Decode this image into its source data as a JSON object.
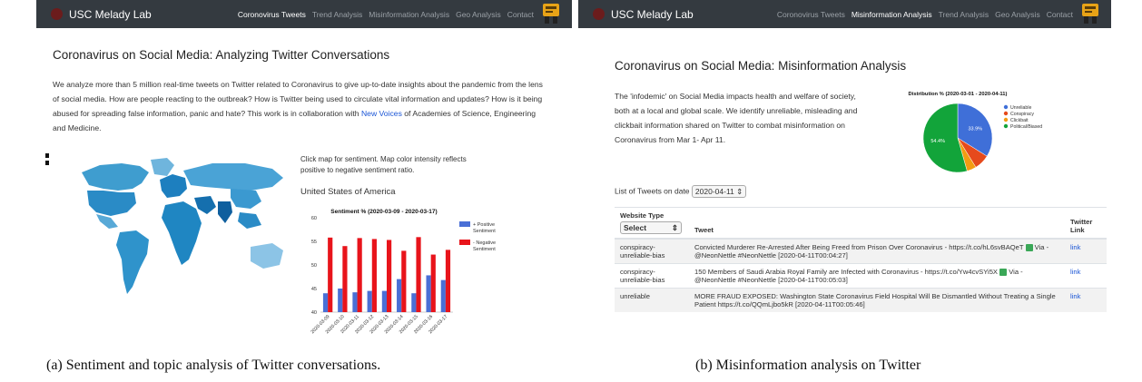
{
  "panel_a": {
    "brand": "USC Melady Lab",
    "nav": [
      "Coronovirus Tweets",
      "Trend Analysis",
      "Misinformation Analysis",
      "Geo Analysis",
      "Contact"
    ],
    "active_nav": "Coronovirus Tweets",
    "title": "Coronavirus on Social Media: Analyzing Twitter Conversations",
    "intro": {
      "text": "We analyze more than 5 million real-time tweets on Twitter related to Coronavirus to give up-to-date insights about the pandemic from the lens of social media. How are people reacting to the outbreak? How is Twitter being used to circulate vital information and updates? How is it being abused for spreading false information, panic and hate? This work is in collaboration with ",
      "link_text": "New Voices",
      "text_after": " of Academies of Science, Engineering and Medicine."
    },
    "map_hint": "Click map for sentiment. Map color intensity reflects positive to negative sentiment ratio.",
    "selected_country": "United States of America",
    "caption": "(a) Sentiment and topic analysis of Twitter conversations."
  },
  "panel_b": {
    "brand": "USC Melady Lab",
    "nav": [
      "Coronovirus Tweets",
      "Misinformation Analysis",
      "Trend Analysis",
      "Geo Analysis",
      "Contact"
    ],
    "active_nav": "Misinformation Analysis",
    "title": "Coronavirus on Social Media: Misinformation Analysis",
    "intro": "The 'infodemic' on Social Media impacts health and welfare of society, both at a local and global scale. We identify unreliable, misleading and clickbait information shared on Twitter to combat misinformation on Coronavirus from Mar 1- Apr 11.",
    "date_label": "List of Tweets on date",
    "date_value": "2020-04-11",
    "table": {
      "headers": [
        "Website Type",
        "Tweet",
        "Twitter Link"
      ],
      "filter_value": "Select",
      "rows": [
        {
          "type": "conspiracy-unreliable-bias",
          "tweet": "Convicted Murderer Re-Arrested After Being Freed from Prison Over Coronavirus - https://t.co/hL6svBAQeT",
          "tweet_after": " Via - @NeonNettle #NeonNettle [2020-04-11T00:04:27]",
          "link": "link"
        },
        {
          "type": "conspiracy-unreliable-bias",
          "tweet": "150 Members of Saudi Arabia Royal Family are Infected with Coronavirus - https://t.co/Yw4cvSYi5X",
          "tweet_after": " Via - @NeonNettle #NeonNettle [2020-04-11T00:05:03]",
          "link": "link"
        },
        {
          "type": "unreliable",
          "tweet": "MORE FRAUD EXPOSED: Washington State Coronavirus Field Hospital Will Be Dismantled Without Treating a Single Patient https://t.co/QQmLjbo5kR [2020-04-11T00:05:46]",
          "tweet_after": "",
          "link": "link"
        }
      ]
    },
    "caption": "(b) Misinformation analysis on Twitter"
  },
  "chart_data": [
    {
      "type": "bar",
      "title": "Sentiment % (2020-03-09 - 2020-03-17)",
      "categories": [
        "2020-03-09",
        "2020-03-10",
        "2020-03-11",
        "2020-03-12",
        "2020-03-13",
        "2020-03-14",
        "2020-03-15",
        "2020-03-16",
        "2020-03-17"
      ],
      "series": [
        {
          "name": "+ Positive Sentiment",
          "color": "#4a6fd6",
          "values": [
            44.0,
            45.0,
            44.2,
            44.5,
            44.5,
            47.0,
            44.0,
            47.8,
            46.8
          ]
        },
        {
          "name": "- Negative Sentiment",
          "color": "#e8141b",
          "values": [
            55.8,
            54.0,
            55.7,
            55.5,
            55.3,
            53.0,
            55.9,
            52.2,
            53.2
          ]
        }
      ],
      "yticks": [
        40,
        45,
        50,
        55,
        60
      ],
      "ylim": [
        40,
        60
      ],
      "legend": "right"
    },
    {
      "type": "pie",
      "title": "Distribution % (2020-03-01 - 2020-04-11)",
      "labels": [
        "Unreliable",
        "Conspiracy",
        "Clickbait",
        "Political/Biased"
      ],
      "values": [
        33.9,
        7.3,
        4.4,
        54.4
      ],
      "colors": [
        "#3f6fd8",
        "#e64a1c",
        "#f39c12",
        "#12a43a"
      ],
      "data_labels": [
        "33.9%",
        "",
        "",
        "54.4%"
      ],
      "legend": "right"
    }
  ]
}
